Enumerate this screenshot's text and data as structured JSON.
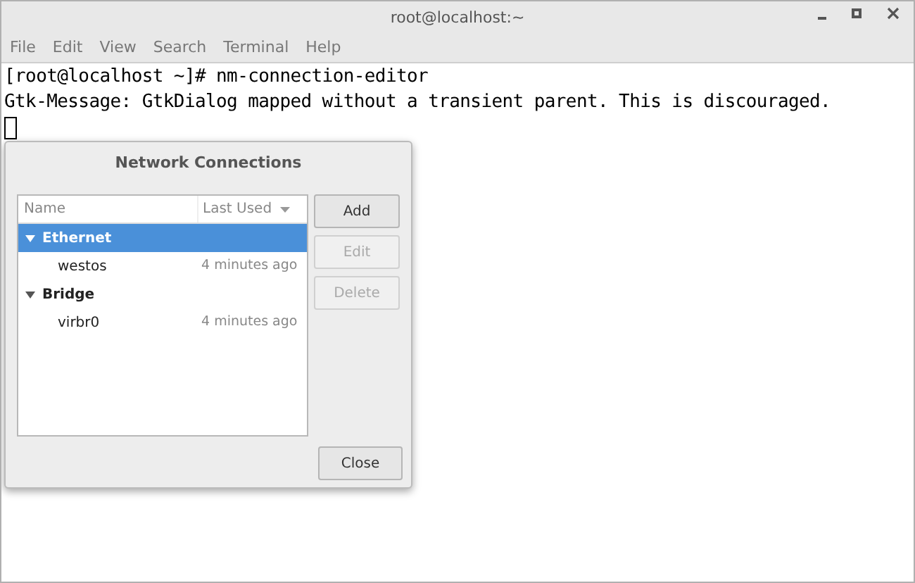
{
  "window": {
    "title": "root@localhost:~"
  },
  "menu": [
    "File",
    "Edit",
    "View",
    "Search",
    "Terminal",
    "Help"
  ],
  "terminal": {
    "lines": [
      "[root@localhost ~]# nm-connection-editor",
      "Gtk-Message: GtkDialog mapped without a transient parent. This is discouraged."
    ]
  },
  "dialog": {
    "title": "Network Connections",
    "columns": [
      "Name",
      "Last Used"
    ],
    "groups": [
      {
        "name": "Ethernet",
        "expanded": true,
        "selected": true,
        "children": [
          {
            "name": "westos",
            "last_used": "4 minutes ago"
          }
        ]
      },
      {
        "name": "Bridge",
        "expanded": true,
        "selected": false,
        "children": [
          {
            "name": "virbr0",
            "last_used": "4 minutes ago"
          }
        ]
      }
    ],
    "buttons": [
      {
        "label": "Add",
        "disabled": false
      },
      {
        "label": "Edit",
        "disabled": true
      },
      {
        "label": "Delete",
        "disabled": true
      }
    ],
    "close": "Close"
  }
}
